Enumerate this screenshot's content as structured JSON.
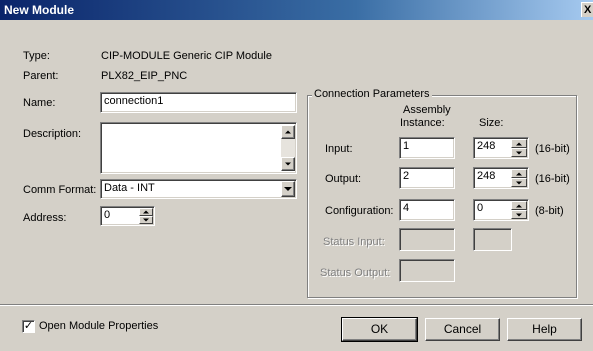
{
  "window": {
    "title": "New Module",
    "close_glyph": "X"
  },
  "fields": {
    "type_label": "Type:",
    "type_value": "CIP-MODULE Generic CIP Module",
    "parent_label": "Parent:",
    "parent_value": "PLX82_EIP_PNC",
    "name_label": "Name:",
    "name_value": "connection1",
    "description_label": "Description:",
    "description_value": "",
    "comm_format_label": "Comm Format:",
    "comm_format_value": "Data - INT",
    "address_label": "Address:",
    "address_value": "0"
  },
  "connection_parameters": {
    "title": "Connection Parameters",
    "col_assembly_line1": "Assembly",
    "col_assembly_line2": "Instance:",
    "col_size": "Size:",
    "rows": [
      {
        "label": "Input:",
        "instance": "1",
        "size": "248",
        "unit": "(16-bit)"
      },
      {
        "label": "Output:",
        "instance": "2",
        "size": "248",
        "unit": "(16-bit)"
      },
      {
        "label": "Configuration:",
        "instance": "4",
        "size": "0",
        "unit": "(8-bit)"
      }
    ],
    "status_input_label": "Status Input:",
    "status_output_label": "Status Output:"
  },
  "footer": {
    "open_props_label": "Open Module Properties",
    "open_props_checked": true,
    "check_glyph": "✓",
    "ok_label": "OK",
    "cancel_label": "Cancel",
    "help_label": "Help"
  },
  "colors": {
    "titlebar_start": "#0a246a",
    "titlebar_end": "#a6caf0",
    "dialog_bg": "#d4d0c8",
    "disabled_text": "#808080"
  }
}
